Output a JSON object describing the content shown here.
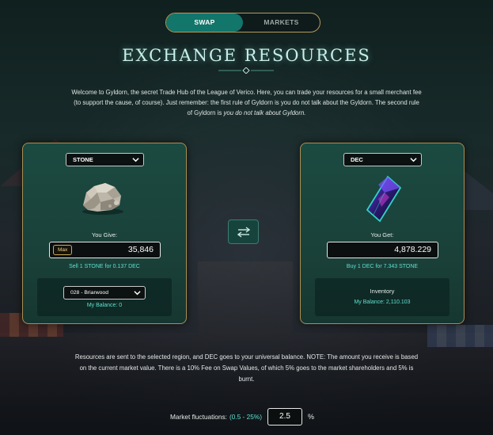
{
  "toggle": {
    "swap_label": "SWAP",
    "markets_label": "MARKETS"
  },
  "title": "EXCHANGE RESOURCES",
  "intro": {
    "text": "Welcome to Gyldorn, the secret Trade Hub of the League of Verico. Here, you can trade your resources for a small merchant fee (to support the cause, of course). Just remember: the first rule of Gyldorn is you do not talk about the Gyldorn. The second rule of Gyldorn is ",
    "emphasis": "you do not talk about Gyldorn."
  },
  "left_panel": {
    "resource_select": "STONE",
    "give_label": "You Give:",
    "max_label": "Max",
    "amount": "35,846",
    "rate": "Sell 1 STONE for 0.137 DEC",
    "region_select": "028 - Briarwood",
    "balance": "My Balance: 0"
  },
  "right_panel": {
    "resource_select": "DEC",
    "get_label": "You Get:",
    "amount": "4,878.229",
    "rate": "Buy 1 DEC for 7.343 STONE",
    "inventory_label": "Inventory",
    "balance": "My Balance: 2,110.103"
  },
  "notice": "Resources are sent to the selected region, and DEC goes to your universal balance. NOTE: The amount you receive is based on the current market value. There is a 10% Fee on Swap Values, of which 5% goes to the market shareholders and 5% is burnt.",
  "fluctuations": {
    "label": "Market fluctuations:",
    "range": "(0.5 - 25%)",
    "value": "2.5",
    "unit": "%"
  },
  "icons": {
    "stone": "stone-icon",
    "dec": "dec-crystal-icon",
    "swap": "swap-arrows-icon",
    "chevron": "chevron-down-icon"
  },
  "colors": {
    "accent_teal": "#12766a",
    "gold_border": "#b49a5a",
    "teal_text": "#5fe0cf",
    "panel_green": "#1b4a41"
  }
}
